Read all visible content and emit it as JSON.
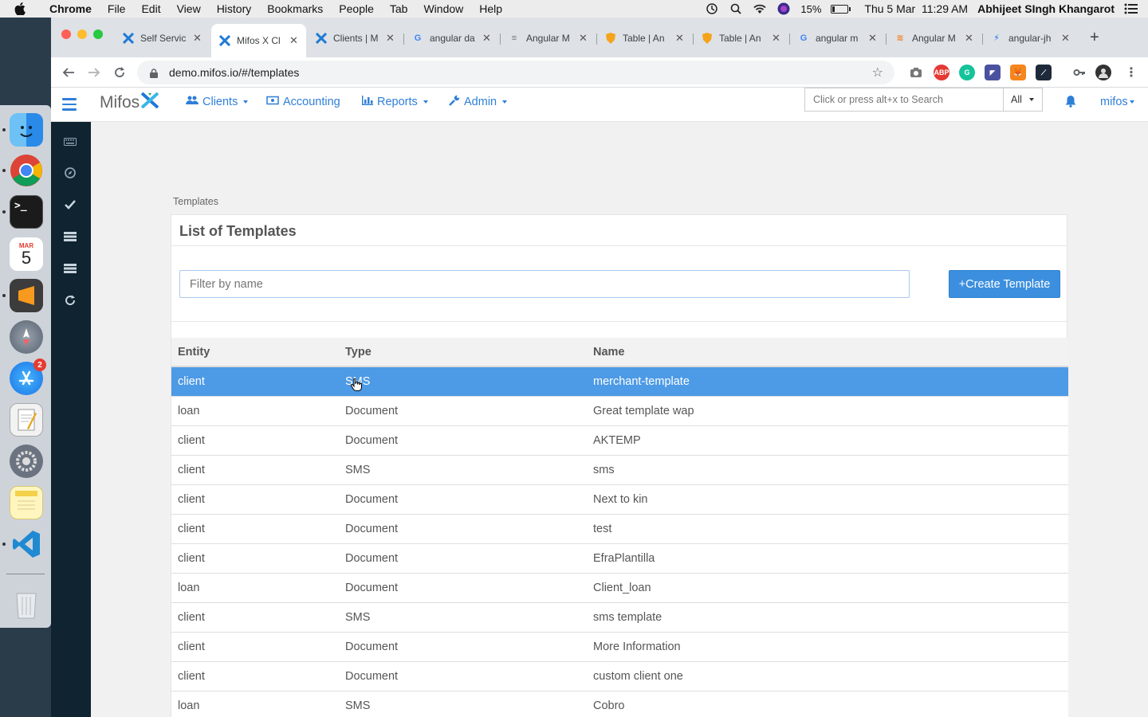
{
  "menubar": {
    "app": "Chrome",
    "items": [
      "File",
      "Edit",
      "View",
      "History",
      "Bookmarks",
      "People",
      "Tab",
      "Window",
      "Help"
    ],
    "battery": "15%",
    "battery_level": 0.15,
    "datetime": "Thu 5 Mar  11:29 AM",
    "user": "Abhijeet SIngh Khangarot"
  },
  "dock": {
    "apps": [
      "finder",
      "chrome",
      "terminal",
      "calendar",
      "sublime-text",
      "launchpad",
      "app-store",
      "textedit",
      "system-preferences",
      "notes",
      "vscode",
      "trash"
    ],
    "calendar_month": "MAR",
    "calendar_day": "5",
    "app_store_badge": "2"
  },
  "browser": {
    "tabs": [
      {
        "title": "Self Servic",
        "icon": "mifos-icon"
      },
      {
        "title": "Mifos X Cl",
        "icon": "mifos-icon",
        "active": true
      },
      {
        "title": "Clients | M",
        "icon": "mifos-icon"
      },
      {
        "title": "angular da",
        "icon": "google-icon"
      },
      {
        "title": "Angular M",
        "icon": "angular-material-icon"
      },
      {
        "title": "Table | An",
        "icon": "shield-icon"
      },
      {
        "title": "Table | An",
        "icon": "shield-icon"
      },
      {
        "title": "angular m",
        "icon": "google-icon"
      },
      {
        "title": "Angular M",
        "icon": "stackoverflow-icon"
      },
      {
        "title": "angular-jh",
        "icon": "bolt-icon"
      }
    ],
    "url": "demo.mifos.io/#/templates"
  },
  "app": {
    "brand": "Mifos",
    "nav": {
      "clients": "Clients",
      "accounting": "Accounting",
      "reports": "Reports",
      "admin": "Admin"
    },
    "search_placeholder": "Click or press alt+x to Search",
    "search_scope": "All",
    "user": "mifos",
    "accent": "#2f7fd8"
  },
  "page": {
    "breadcrumb": "Templates",
    "title": "List of Templates",
    "filter_placeholder": "Filter by name",
    "create_button": "+Create Template",
    "columns": {
      "entity": "Entity",
      "type": "Type",
      "name": "Name"
    },
    "rows": [
      {
        "entity": "client",
        "type": "SMS",
        "name": "merchant-template",
        "selected": true
      },
      {
        "entity": "loan",
        "type": "Document",
        "name": "Great template wap"
      },
      {
        "entity": "client",
        "type": "Document",
        "name": "AKTEMP"
      },
      {
        "entity": "client",
        "type": "SMS",
        "name": "sms"
      },
      {
        "entity": "client",
        "type": "Document",
        "name": "Next to kin"
      },
      {
        "entity": "client",
        "type": "Document",
        "name": "test"
      },
      {
        "entity": "client",
        "type": "Document",
        "name": "EfraPlantilla"
      },
      {
        "entity": "loan",
        "type": "Document",
        "name": "Client_loan"
      },
      {
        "entity": "client",
        "type": "SMS",
        "name": "sms template"
      },
      {
        "entity": "client",
        "type": "Document",
        "name": "More Information"
      },
      {
        "entity": "client",
        "type": "Document",
        "name": "custom client one"
      },
      {
        "entity": "loan",
        "type": "SMS",
        "name": "Cobro"
      }
    ]
  }
}
